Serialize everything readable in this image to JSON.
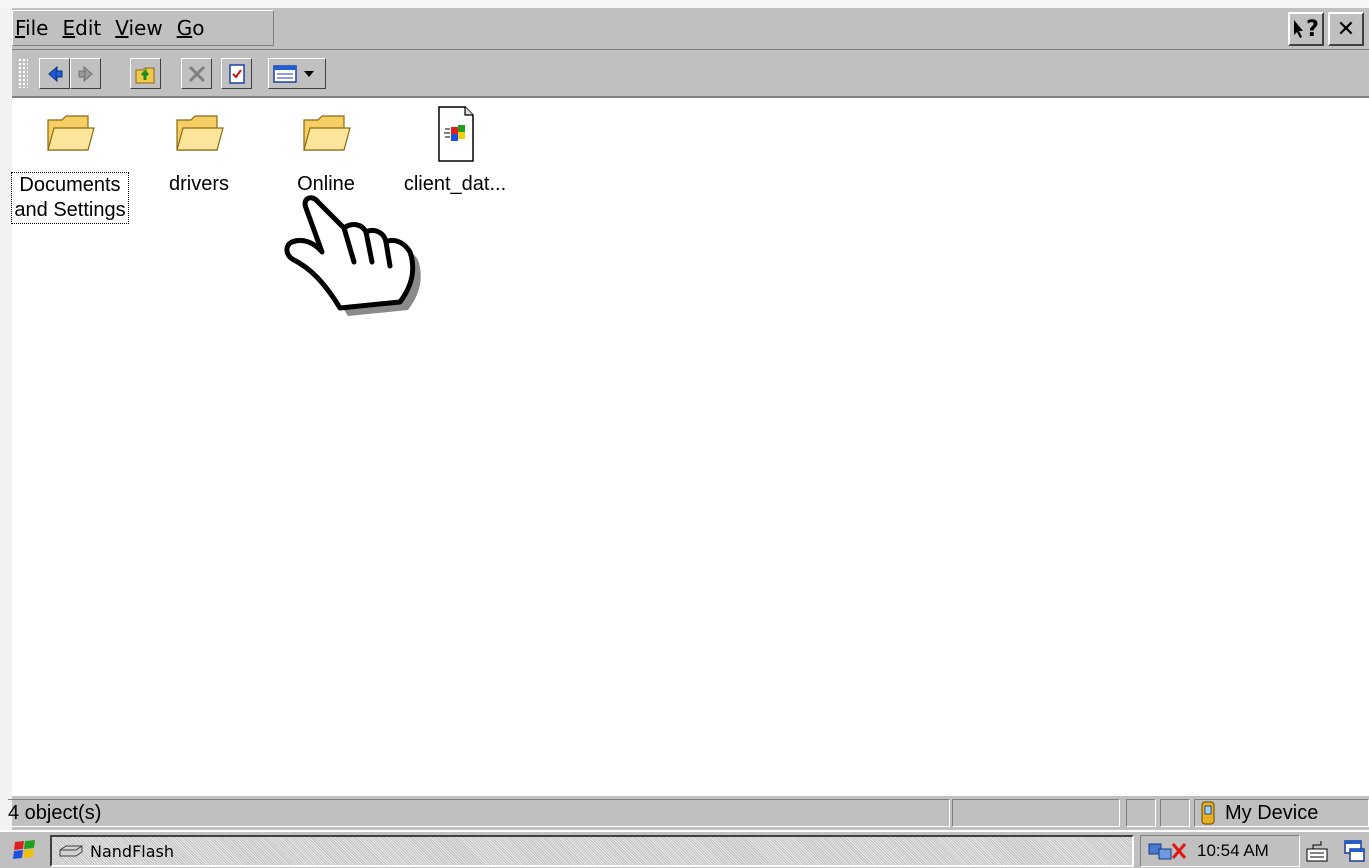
{
  "menubar": {
    "items": [
      {
        "underline": "F",
        "rest": "ile"
      },
      {
        "underline": "E",
        "rest": "dit"
      },
      {
        "underline": "V",
        "rest": "iew"
      },
      {
        "underline": "G",
        "rest": "o"
      }
    ],
    "help_label": "?",
    "close_label": "✕"
  },
  "files": [
    {
      "name": "Documents and Settings",
      "line1": "Documents",
      "line2": "and Settings",
      "type": "folder"
    },
    {
      "name": "drivers",
      "line1": "drivers",
      "line2": "",
      "type": "folder"
    },
    {
      "name": "Online",
      "line1": "Online",
      "line2": "",
      "type": "folder"
    },
    {
      "name": "client_dat...",
      "line1": "client_dat...",
      "line2": "",
      "type": "file"
    }
  ],
  "statusbar": {
    "object_count": "4 object(s)",
    "location": "My Device"
  },
  "taskbar": {
    "task_label": "NandFlash",
    "clock": "10:54 AM"
  },
  "icons": {
    "back": "back-arrow-icon",
    "forward": "forward-arrow-icon",
    "up": "up-folder-icon",
    "delete": "delete-icon",
    "properties": "properties-icon",
    "views": "views-icon",
    "cursor": "hand-pointer-icon"
  },
  "colors": {
    "chrome": "#c0c0c0",
    "folder": "#f7d77a",
    "accent_blue": "#1f5fd6"
  }
}
